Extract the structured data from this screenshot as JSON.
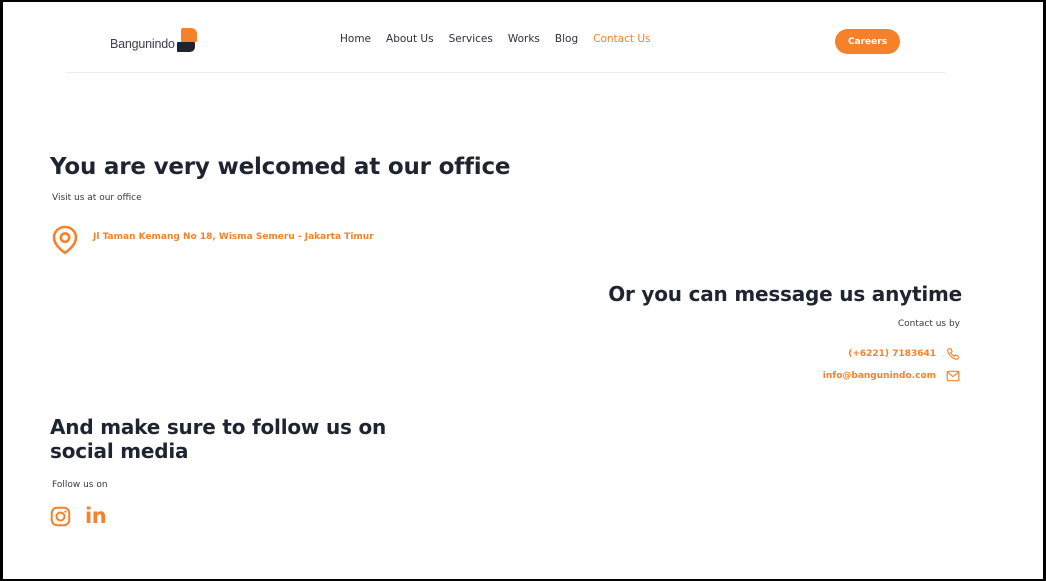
{
  "header": {
    "logo_text": "Bangunindo",
    "nav": [
      {
        "label": "Home",
        "active": false
      },
      {
        "label": "About Us",
        "active": false
      },
      {
        "label": "Services",
        "active": false
      },
      {
        "label": "Works",
        "active": false
      },
      {
        "label": "Blog",
        "active": false
      },
      {
        "label": "Contact Us",
        "active": true
      }
    ],
    "careers_label": "Careers"
  },
  "office": {
    "title": "You are very welcomed at our office",
    "subtitle": "Visit us at our office",
    "address": "Jl Taman Kemang No 18, Wisma Semeru - Jakarta Timur",
    "icon": "location-pin-icon"
  },
  "message": {
    "title": "Or you can message us anytime",
    "subtitle": "Contact us by",
    "phone": "(+6221) 7183641",
    "email": "info@bangunindo.com",
    "phone_icon": "phone-icon",
    "email_icon": "mail-icon"
  },
  "social": {
    "title": "And make sure to follow us on social media",
    "subtitle": "Follow us on",
    "icons": [
      "instagram-icon",
      "linkedin-icon"
    ],
    "linkedin_glyph": "in"
  },
  "colors": {
    "accent": "#f5822a",
    "heading": "#1f2530",
    "text": "#333a44"
  }
}
